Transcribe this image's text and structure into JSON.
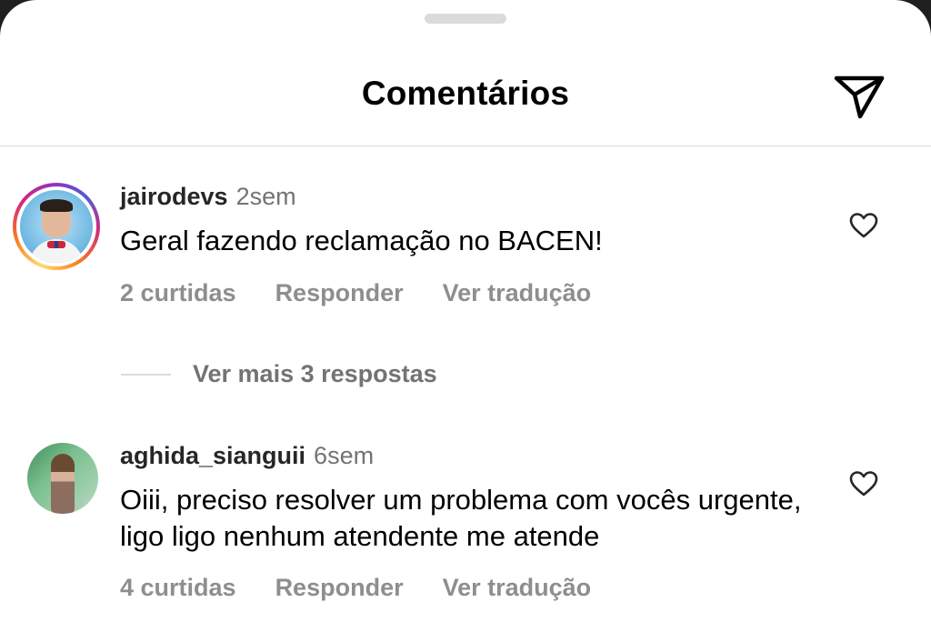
{
  "header": {
    "title": "Comentários"
  },
  "comments": [
    {
      "username": "jairodevs",
      "time": "2sem",
      "text": "Geral fazendo reclamação no BACEN!",
      "likes": "2 curtidas",
      "reply": "Responder",
      "translate": "Ver tradução",
      "more_replies": "Ver mais 3 respostas"
    },
    {
      "username": "aghida_sianguii",
      "time": "6sem",
      "text": "Oiii, preciso resolver um problema com vocês urgente, ligo ligo nenhum atendente me atende",
      "likes": "4 curtidas",
      "reply": "Responder",
      "translate": "Ver tradução"
    }
  ],
  "icons": {
    "share": "paper-plane-icon",
    "like": "heart-icon"
  },
  "colors": {
    "text": "#000000",
    "secondary": "#8e8e8e",
    "divider": "#dbdbdb"
  }
}
